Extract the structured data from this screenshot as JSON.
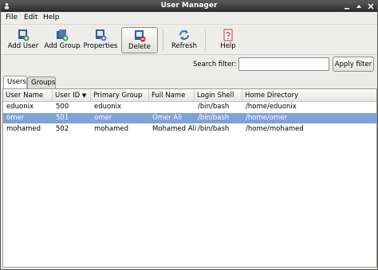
{
  "window": {
    "title": "User Manager"
  },
  "menu": [
    "File",
    "Edit",
    "Help"
  ],
  "toolbar": {
    "add_user": "Add User",
    "add_group": "Add Group",
    "properties": "Properties",
    "delete": "Delete",
    "refresh": "Refresh",
    "help": "Help"
  },
  "filter": {
    "label": "Search filter:",
    "value": "",
    "apply": "Apply filter"
  },
  "tabs": [
    "Users",
    "Groups"
  ],
  "active_tab": "Users",
  "table": {
    "columns": [
      "User Name",
      "User ID",
      "Primary Group",
      "Full Name",
      "Login Shell",
      "Home Directory"
    ],
    "sort_column": "User ID",
    "rows": [
      [
        "eduonix",
        "500",
        "eduonix",
        "",
        "/bin/bash",
        "/home/eduonix"
      ],
      [
        "omer",
        "501",
        "omer",
        "Omer Ali",
        "/bin/bash",
        "/home/omer"
      ],
      [
        "mohamed",
        "502",
        "mohamed",
        "Mohamed Ali",
        "/bin/bash",
        "/home/mohamed"
      ]
    ],
    "selected_row": 1
  },
  "icons": {
    "window": "users-icon",
    "minimize": "minimize-icon",
    "maximize": "maximize-icon",
    "close": "close-icon",
    "add_user": "add-user-icon",
    "add_group": "add-group-icon",
    "properties": "properties-icon",
    "delete": "delete-icon",
    "refresh": "refresh-icon",
    "help": "help-icon"
  },
  "colors": {
    "selection": "#7fa1d8",
    "titlebar": "#3a3a3a"
  }
}
